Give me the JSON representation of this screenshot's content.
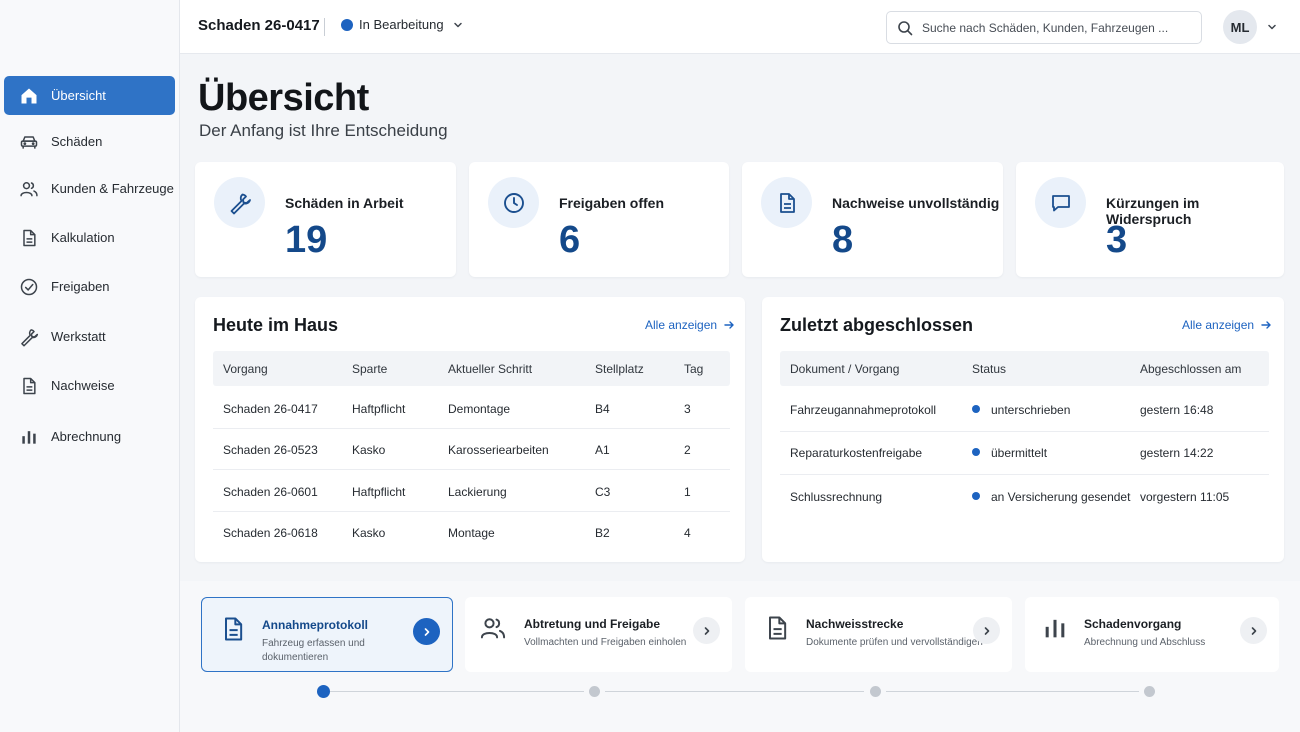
{
  "header": {
    "case_title": "Schaden 26-0417",
    "status": "In Bearbeitung",
    "search_placeholder": "Suche nach Schäden, Kunden, Fahrzeugen ...",
    "avatar_initials": "ML"
  },
  "sidebar": {
    "items": [
      {
        "label": "Übersicht",
        "icon": "home-icon",
        "active": true
      },
      {
        "label": "Schäden",
        "icon": "car-icon"
      },
      {
        "label": "Kunden & Fahrzeuge",
        "icon": "users-icon"
      },
      {
        "label": "Kalkulation",
        "icon": "document-icon"
      },
      {
        "label": "Freigaben",
        "icon": "check-circle-icon"
      },
      {
        "label": "Werkstatt",
        "icon": "wrench-icon"
      },
      {
        "label": "Nachweise",
        "icon": "document-icon"
      },
      {
        "label": "Abrechnung",
        "icon": "bar-chart-icon"
      }
    ]
  },
  "page": {
    "title": "Übersicht",
    "subtitle": "Der Anfang ist Ihre Entscheidung"
  },
  "kpis": [
    {
      "label": "Schäden in Arbeit",
      "value": "19",
      "icon": "wrench-icon"
    },
    {
      "label": "Freigaben offen",
      "value": "6",
      "icon": "clock-icon"
    },
    {
      "label": "Nachweise unvollständig",
      "value": "8",
      "icon": "document-icon"
    },
    {
      "label": "Kürzungen im Widerspruch",
      "value": "3",
      "icon": "chat-icon"
    }
  ],
  "today": {
    "title": "Heute im Haus",
    "link": "Alle anzeigen",
    "columns": [
      "Vorgang",
      "Sparte",
      "Aktueller Schritt",
      "Stellplatz",
      "Tag"
    ],
    "rows": [
      [
        "Schaden 26-0417",
        "Haftpflicht",
        "Demontage",
        "B4",
        "3"
      ],
      [
        "Schaden 26-0523",
        "Kasko",
        "Karosseriearbeiten",
        "A1",
        "2"
      ],
      [
        "Schaden 26-0601",
        "Haftpflicht",
        "Lackierung",
        "C3",
        "1"
      ],
      [
        "Schaden 26-0618",
        "Kasko",
        "Montage",
        "B2",
        "4"
      ]
    ]
  },
  "recent": {
    "title": "Zuletzt abgeschlossen",
    "link": "Alle anzeigen",
    "columns": [
      "Dokument / Vorgang",
      "Status",
      "Abgeschlossen am"
    ],
    "rows": [
      [
        "Fahrzeugannahmeprotokoll",
        "unterschrieben",
        "gestern 16:48"
      ],
      [
        "Reparaturkostenfreigabe",
        "übermittelt",
        "gestern 14:22"
      ],
      [
        "Schlussrechnung",
        "an Versicherung gesendet",
        "vorgestern 11:05"
      ]
    ]
  },
  "steps": [
    {
      "title": "Annahmeprotokoll",
      "desc": "Fahrzeug erfassen und dokumentieren",
      "icon": "document-icon",
      "active": true
    },
    {
      "title": "Abtretung und Freigabe",
      "desc": "Vollmachten und Freigaben einholen",
      "icon": "users-icon"
    },
    {
      "title": "Nachweisstrecke",
      "desc": "Dokumente prüfen und vervollständigen",
      "icon": "document-icon"
    },
    {
      "title": "Schadenvorgang",
      "desc": "Abrechnung und Abschluss",
      "icon": "bar-chart-icon"
    }
  ],
  "colors": {
    "accent": "#2f73c6",
    "accent_dark": "#14498a",
    "status_dot": "#1d63c0"
  }
}
